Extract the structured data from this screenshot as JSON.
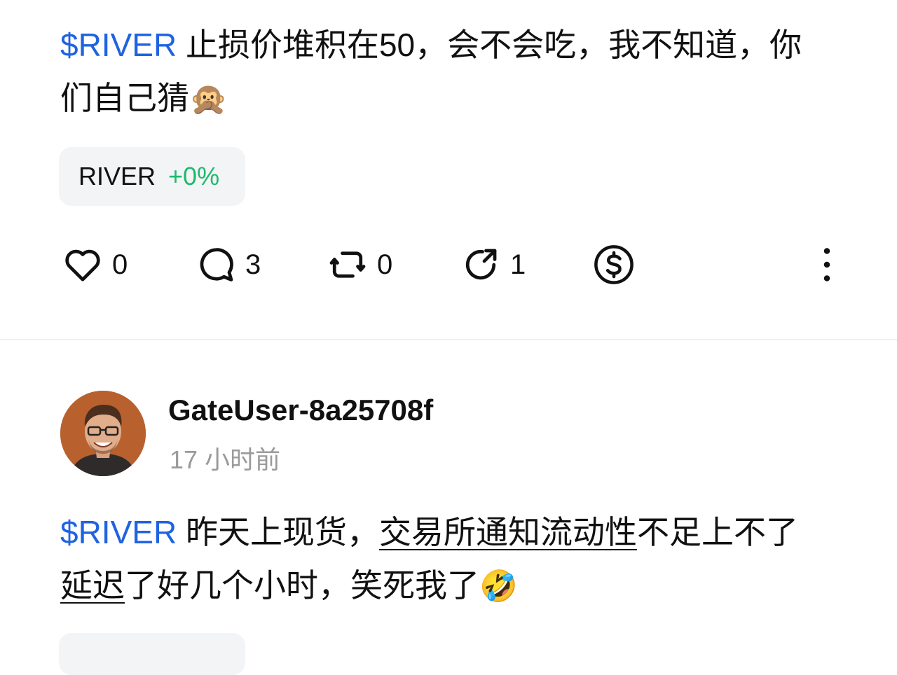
{
  "post1": {
    "cashtag": "$RIVER",
    "text": " 止损价堆积在50，会不会吃，我不知道，你们自己猜",
    "emoji": "🙊",
    "token": {
      "symbol": "RIVER",
      "change": "+0%"
    },
    "actions": {
      "likes": "0",
      "comments": "3",
      "reposts": "0",
      "shares": "1"
    }
  },
  "post2": {
    "author": "GateUser-8a25708f",
    "time": "17 小时前",
    "cashtag": "$RIVER",
    "text_before": " 昨天上现货，",
    "text_underlined_1": "交易所通知流动性",
    "text_middle": "不足上不了",
    "text_underlined_2": "延迟",
    "text_after": "了好几个小时，笑死我了",
    "emoji": "🤣"
  },
  "colors": {
    "cashtag": "#1f63e0",
    "positive": "#1fba6c",
    "chip_bg": "#f3f4f6",
    "muted": "#9a9a9a"
  },
  "icons": [
    "heart-icon",
    "comment-icon",
    "repost-icon",
    "share-icon",
    "tip-dollar-icon",
    "more-vertical-icon"
  ]
}
